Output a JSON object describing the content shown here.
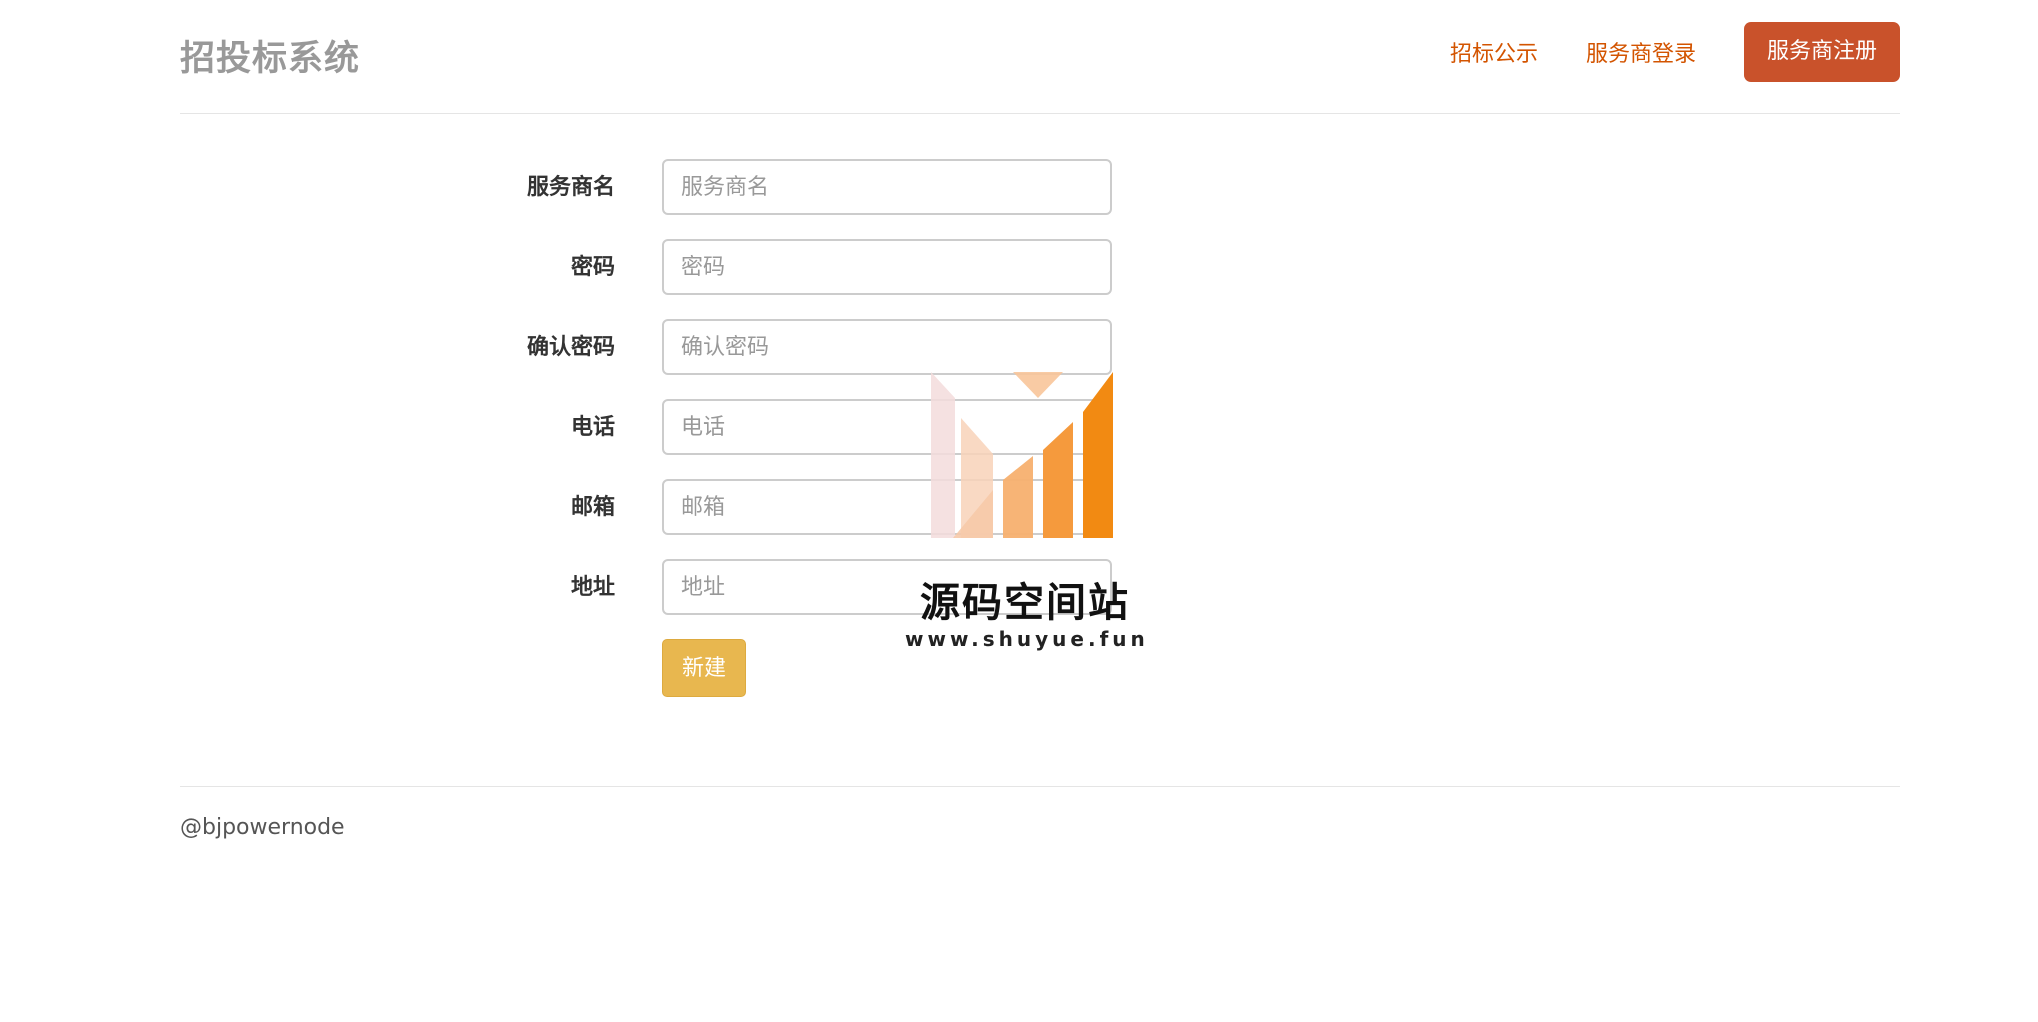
{
  "header": {
    "brand": "招投标系统",
    "nav": {
      "announce_label": "招标公示",
      "login_label": "服务商登录",
      "register_label": "服务商注册"
    }
  },
  "form": {
    "fields": [
      {
        "label": "服务商名",
        "placeholder": "服务商名",
        "value": ""
      },
      {
        "label": "密码",
        "placeholder": "密码",
        "value": ""
      },
      {
        "label": "确认密码",
        "placeholder": "确认密码",
        "value": ""
      },
      {
        "label": "电话",
        "placeholder": "电话",
        "value": ""
      },
      {
        "label": "邮箱",
        "placeholder": "邮箱",
        "value": ""
      },
      {
        "label": "地址",
        "placeholder": "地址",
        "value": ""
      }
    ],
    "submit_label": "新建"
  },
  "footer": {
    "text": "@bjpowernode"
  },
  "watermark": {
    "title": "源码空间站",
    "url": "www.shuyue.fun"
  },
  "colors": {
    "accent": "#c9522b",
    "nav_link": "#d35400",
    "submit": "#e8b74f",
    "brand": "#999999"
  }
}
